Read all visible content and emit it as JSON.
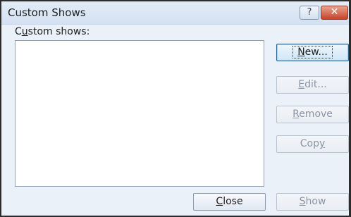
{
  "dialog": {
    "title": "Custom Shows",
    "help_glyph": "?",
    "close_glyph": "✕"
  },
  "list": {
    "label_prefix": "C",
    "label_underlined": "u",
    "label_suffix": "stom shows:"
  },
  "buttons": {
    "new": {
      "underlined": "N",
      "rest": "ew..."
    },
    "edit": {
      "underlined": "E",
      "rest": "dit..."
    },
    "remove": {
      "underlined": "R",
      "rest": "emove"
    },
    "copy": {
      "prefix": "Cop",
      "underlined": "y"
    },
    "close": {
      "underlined": "C",
      "rest": "lose"
    },
    "show": {
      "underlined": "S",
      "rest": "how"
    }
  }
}
